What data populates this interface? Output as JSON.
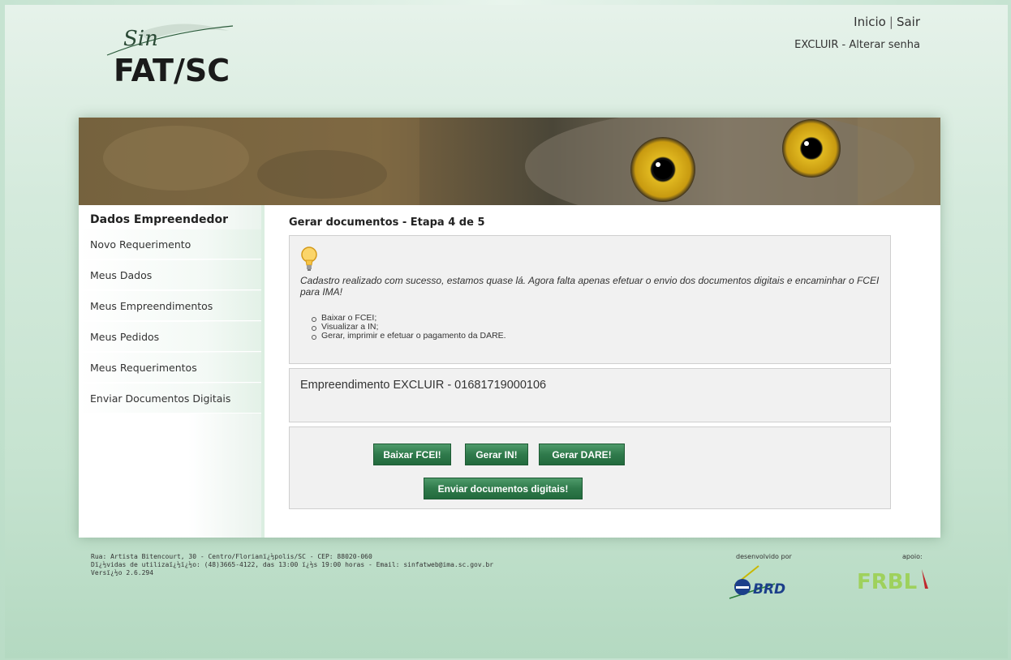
{
  "header": {
    "logo_script": "Sin",
    "logo_text": "FAT/SC",
    "link_inicio": "Inicio",
    "separator": "|",
    "link_sair": "Sair",
    "user_name": "EXCLUIR",
    "dash": "-",
    "link_alterar_senha": "Alterar senha"
  },
  "sidebar": {
    "title": "Dados Empreendedor",
    "items": [
      {
        "label": "Novo Requerimento"
      },
      {
        "label": "Meus Dados"
      },
      {
        "label": "Meus Empreendimentos"
      },
      {
        "label": "Meus Pedidos"
      },
      {
        "label": "Meus Requerimentos"
      },
      {
        "label": "Enviar Documentos Digitais"
      }
    ]
  },
  "main": {
    "title": "Gerar documentos - Etapa 4 de 5",
    "info_text": "Cadastro realizado com sucesso, estamos quase lá. Agora falta apenas efetuar o envio dos documentos digitais e encaminhar o FCEI para IMA!",
    "steps": [
      "Baixar o FCEI;",
      "Visualizar a IN;",
      "Gerar, imprimir e efetuar o pagamento da DARE."
    ],
    "empreendimento": "Empreendimento EXCLUIR - 01681719000106",
    "buttons": {
      "baixar_fcei": "Baixar FCEI!",
      "gerar_in": "Gerar IN!",
      "gerar_dare": "Gerar DARE!",
      "enviar_docs": "Enviar documentos digitais!"
    }
  },
  "footer": {
    "line1": "Rua: Artista Bitencourt, 30 - Centro/Florianï¿½polis/SC - CEP: 88020-060",
    "line2": "Dï¿½vidas de utilizaï¿½ï¿½o: (48)3665-4122, das 13:00 ï¿½s 19:00 horas - Email: sinfatweb@ima.sc.gov.br",
    "line3": "Versï¿½o 2.6.294",
    "dev_label": "desenvolvido por",
    "apoio_label": "apoio:",
    "brd_text": "BRD",
    "fr_text": "FRBL"
  },
  "colors": {
    "button_green": "#2f7a4b",
    "panel_bg": "#f1f1f1",
    "page_bg": "#cfe6d8"
  }
}
